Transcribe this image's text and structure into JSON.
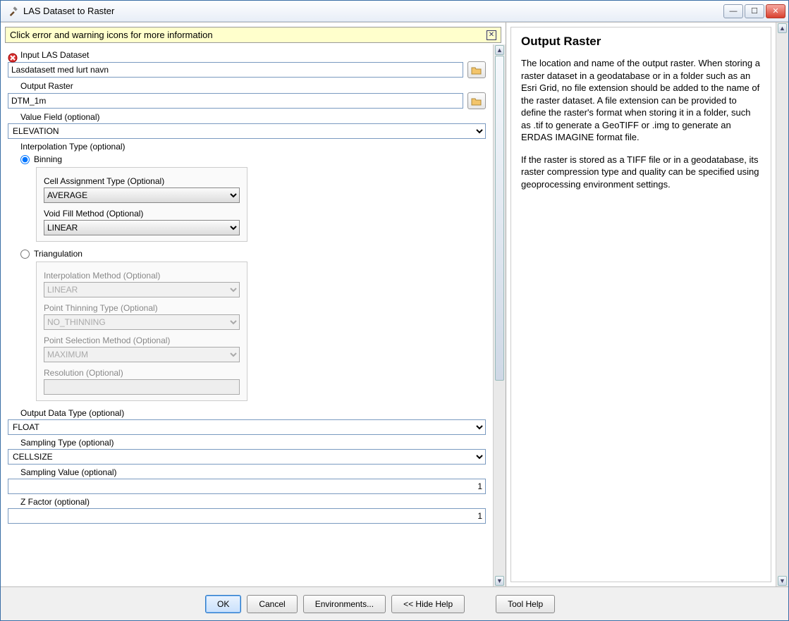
{
  "window": {
    "title": "LAS Dataset to Raster"
  },
  "notice": {
    "text": "Click error and warning icons for more information"
  },
  "form": {
    "inputLas": {
      "label": "Input LAS Dataset",
      "value": "Lasdatasett med lurt navn"
    },
    "outputRaster": {
      "label": "Output Raster",
      "value": "DTM_1m"
    },
    "valueField": {
      "label": "Value Field (optional)",
      "value": "ELEVATION"
    },
    "interpType": {
      "label": "Interpolation Type (optional)"
    },
    "binning": {
      "label": "Binning"
    },
    "triangulation": {
      "label": "Triangulation"
    },
    "cellAssign": {
      "label": "Cell Assignment Type (Optional)",
      "value": "AVERAGE"
    },
    "voidFill": {
      "label": "Void Fill Method (Optional)",
      "value": "LINEAR"
    },
    "interpMethod": {
      "label": "Interpolation Method (Optional)",
      "value": "LINEAR"
    },
    "pointThin": {
      "label": "Point Thinning Type (Optional)",
      "value": "NO_THINNING"
    },
    "pointSel": {
      "label": "Point Selection Method (Optional)",
      "value": "MAXIMUM"
    },
    "resolution": {
      "label": "Resolution (Optional)",
      "value": ""
    },
    "outDataType": {
      "label": "Output Data Type (optional)",
      "value": "FLOAT"
    },
    "samplingType": {
      "label": "Sampling Type (optional)",
      "value": "CELLSIZE"
    },
    "samplingValue": {
      "label": "Sampling Value (optional)",
      "value": "1"
    },
    "zFactor": {
      "label": "Z Factor (optional)",
      "value": "1"
    }
  },
  "buttons": {
    "ok": "OK",
    "cancel": "Cancel",
    "env": "Environments...",
    "hideHelp": "<< Hide Help",
    "toolHelp": "Tool Help"
  },
  "help": {
    "title": "Output Raster",
    "p1": "The location and name of the output raster. When storing a raster dataset in a geodatabase or in a folder such as an Esri Grid, no file extension should be added to the name of the raster dataset. A file extension can be provided to define the raster's format when storing it in a folder, such as .tif to generate a GeoTIFF or .img to generate an ERDAS IMAGINE format file.",
    "p2": "If the raster is stored as a TIFF file or in a geodatabase, its raster compression type and quality can be specified using geoprocessing environment settings."
  }
}
